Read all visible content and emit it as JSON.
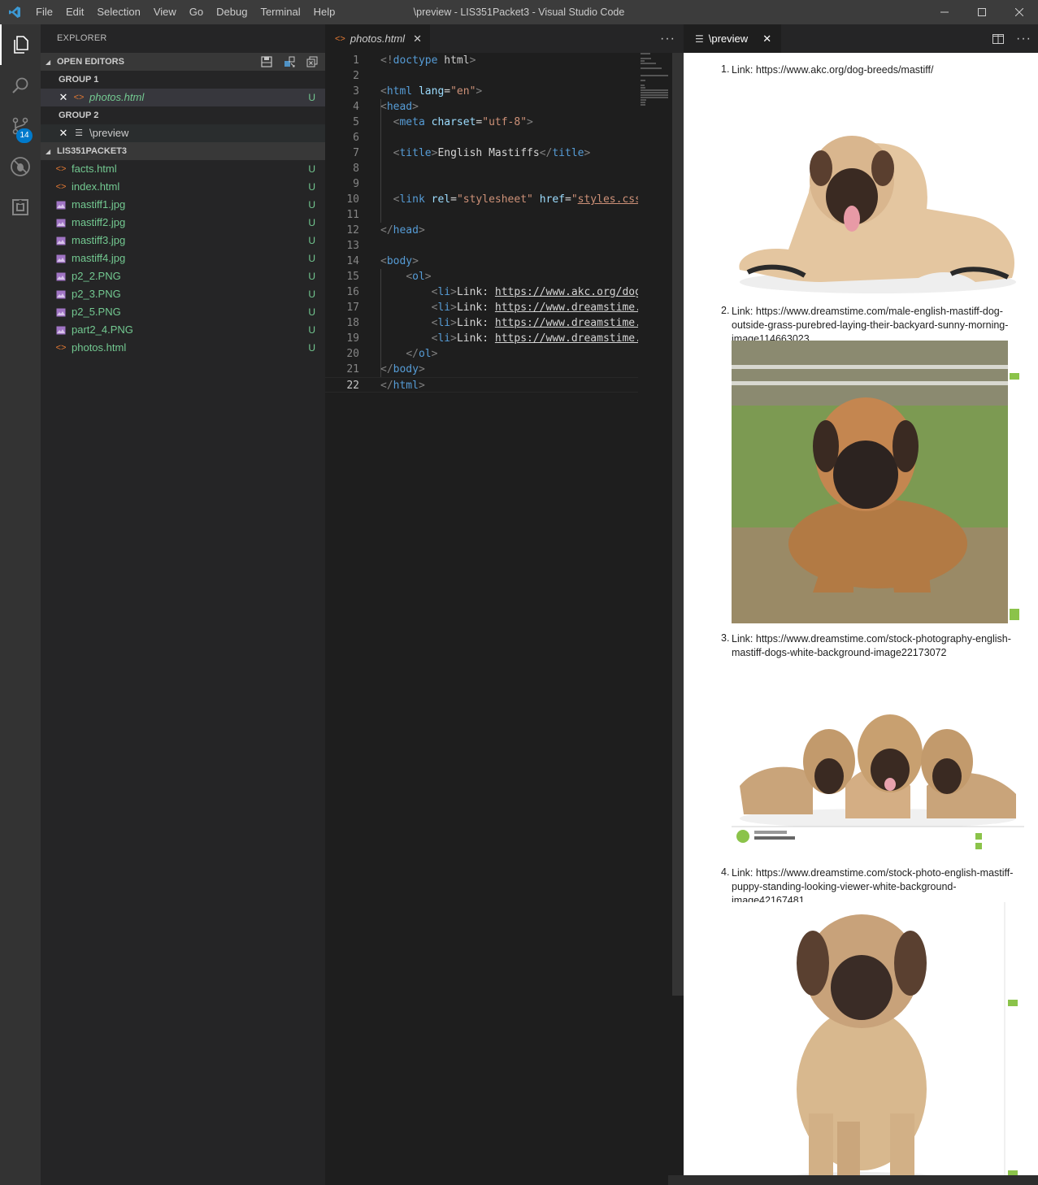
{
  "titlebar": {
    "menu": [
      "File",
      "Edit",
      "Selection",
      "View",
      "Go",
      "Debug",
      "Terminal",
      "Help"
    ],
    "title": "\\preview - LIS351Packet3 - Visual Studio Code"
  },
  "activity": {
    "scm_badge": "14"
  },
  "sidebar": {
    "title": "EXPLORER",
    "open_editors": "OPEN EDITORS",
    "group1": "GROUP 1",
    "group1_file": "photos.html",
    "group2": "GROUP 2",
    "group2_file": "\\preview",
    "project": "LIS351PACKET3",
    "files": [
      {
        "name": "facts.html",
        "type": "html",
        "status": "U"
      },
      {
        "name": "index.html",
        "type": "html",
        "status": "U"
      },
      {
        "name": "mastiff1.jpg",
        "type": "img",
        "status": "U"
      },
      {
        "name": "mastiff2.jpg",
        "type": "img",
        "status": "U"
      },
      {
        "name": "mastiff3.jpg",
        "type": "img",
        "status": "U"
      },
      {
        "name": "mastiff4.jpg",
        "type": "img",
        "status": "U"
      },
      {
        "name": "p2_2.PNG",
        "type": "img",
        "status": "U"
      },
      {
        "name": "p2_3.PNG",
        "type": "img",
        "status": "U"
      },
      {
        "name": "p2_5.PNG",
        "type": "img",
        "status": "U"
      },
      {
        "name": "part2_4.PNG",
        "type": "img",
        "status": "U"
      },
      {
        "name": "photos.html",
        "type": "html",
        "status": "U"
      }
    ],
    "open_status": "U"
  },
  "editor": {
    "tab": "photos.html",
    "code_lines": [
      "<!doctype html>",
      "",
      "<html lang=\"en\">",
      "<head>",
      "  <meta charset=\"utf-8\">",
      "",
      "  <title>English Mastiffs</title>",
      "",
      "",
      "  <link rel=\"stylesheet\" href=\"styles.css\">",
      "",
      "</head>",
      "",
      "<body>",
      "    <ol>",
      "        <li>Link: https://www.akc.org/dog-",
      "        <li>Link: https://www.dreamstime.c",
      "        <li>Link: https://www.dreamstime.c",
      "        <li>Link: https://www.dreamstime.c",
      "    </ol>",
      "</body>",
      "</html>"
    ]
  },
  "preview": {
    "tab": "\\preview",
    "items": [
      {
        "num": "1.",
        "text": "Link: https://www.akc.org/dog-breeds/mastiff/"
      },
      {
        "num": "2.",
        "text": "Link: https://www.dreamstime.com/male-english-mastiff-dog-outside-grass-purebred-laying-their-backyard-sunny-morning-image114663023"
      },
      {
        "num": "3.",
        "text": "Link: https://www.dreamstime.com/stock-photography-english-mastiff-dogs-white-background-image22173072"
      },
      {
        "num": "4.",
        "text": "Link: https://www.dreamstime.com/stock-photo-english-mastiff-puppy-standing-looking-viewer-white-background-image42167481"
      }
    ]
  },
  "colors": {
    "titlebar": "#3c3c3c",
    "activitybar": "#333333",
    "sidebar": "#252526",
    "editor": "#1e1e1e",
    "untracked": "#73c991",
    "badge": "#007acc"
  }
}
